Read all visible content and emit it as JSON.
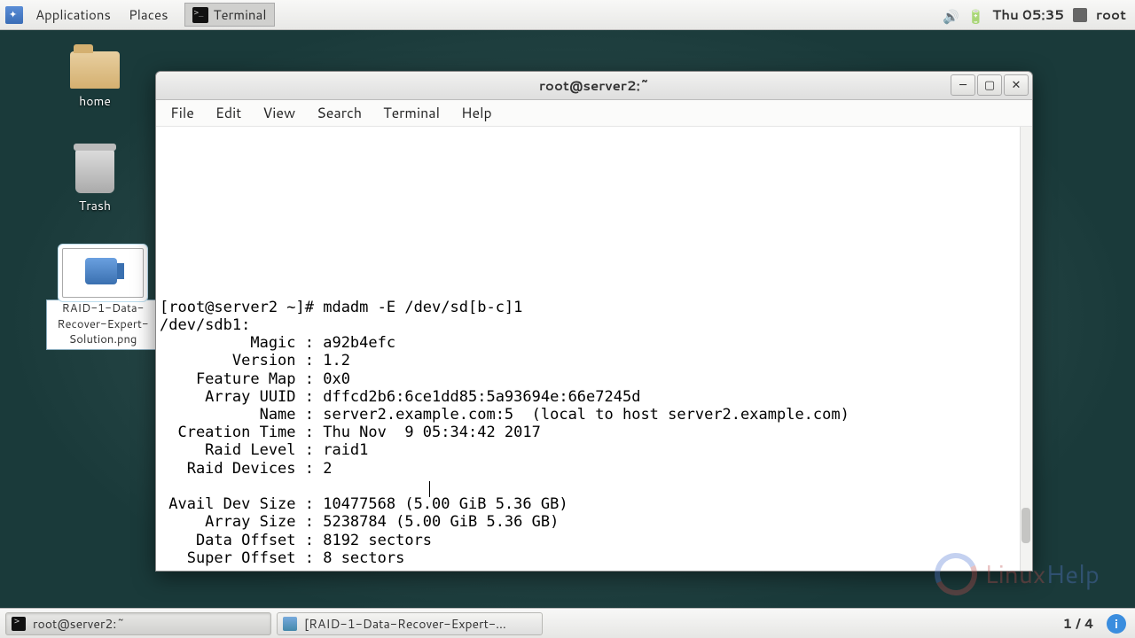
{
  "panel": {
    "applications": "Applications",
    "places": "Places",
    "terminal": "Terminal",
    "clock": "Thu 05:35",
    "user": "root"
  },
  "desktop": {
    "home": "home",
    "trash": "Trash",
    "file": "RAID-1-Data-Recover-Expert-Solution.png"
  },
  "window": {
    "title": "root@server2:~",
    "menu": {
      "file": "File",
      "edit": "Edit",
      "view": "View",
      "search": "Search",
      "terminal": "Terminal",
      "help": "Help"
    }
  },
  "terminal": {
    "prompt": "[root@server2 ~]# mdadm -E /dev/sd[b-c]1",
    "device": "/dev/sdb1:",
    "magic": "          Magic : a92b4efc",
    "version": "        Version : 1.2",
    "feature_map": "    Feature Map : 0x0",
    "array_uuid": "     Array UUID : dffcd2b6:6ce1dd85:5a93694e:66e7245d",
    "name": "           Name : server2.example.com:5  (local to host server2.example.com)",
    "creation": "  Creation Time : Thu Nov  9 05:34:42 2017",
    "raid_level": "     Raid Level : raid1",
    "raid_devices": "   Raid Devices : 2",
    "blank": "",
    "avail": " Avail Dev Size : 10477568 (5.00 GiB 5.36 GB)",
    "array_size": "     Array Size : 5238784 (5.00 GiB 5.36 GB)",
    "data_offset": "    Data Offset : 8192 sectors",
    "super_offset": "   Super Offset : 8 sectors"
  },
  "taskbar": {
    "task1": "root@server2:~",
    "task2": "[RAID-1-Data-Recover-Expert-...",
    "pager": "1 / 4"
  },
  "watermark": {
    "text1": "Linux",
    "text2": "Help"
  }
}
